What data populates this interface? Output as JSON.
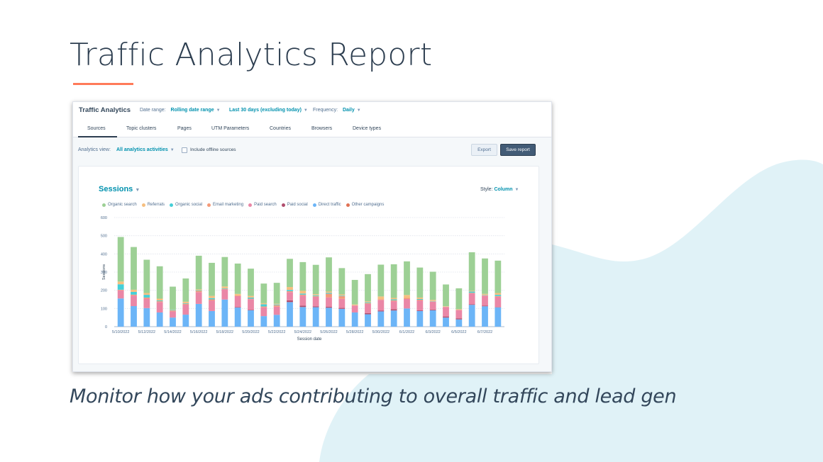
{
  "slide": {
    "title": "Traffic Analytics Report",
    "subtitle": "Monitor how your ads contributing to overall traffic and lead gen",
    "accent_color": "#ff7a59",
    "blob_color": "#e0f2f7"
  },
  "app": {
    "title": "Traffic Analytics",
    "filters": [
      {
        "label": "Date range:",
        "value": "Rolling date range"
      },
      {
        "label": "",
        "value": "Last 30 days (excluding today)"
      },
      {
        "label": "Frequency:",
        "value": "Daily"
      }
    ],
    "tabs": [
      "Sources",
      "Topic clusters",
      "Pages",
      "UTM Parameters",
      "Countries",
      "Browsers",
      "Device types"
    ],
    "active_tab": "Sources",
    "toolbar": {
      "analytics_view_label": "Analytics view:",
      "analytics_view_value": "All analytics activities",
      "include_offline_label": "Include offline sources",
      "include_offline_checked": false,
      "export_label": "Export",
      "save_label": "Save report"
    },
    "card": {
      "metric": "Sessions",
      "style_label": "Style:",
      "style_value": "Column"
    }
  },
  "chart_data": {
    "type": "bar",
    "stacked": true,
    "title": "Sessions",
    "xlabel": "Session date",
    "ylabel": "Sessions",
    "ylim": [
      0,
      600
    ],
    "yticks": [
      0,
      100,
      200,
      300,
      400,
      500,
      600
    ],
    "grid": true,
    "legend_position": "top-left",
    "categories": [
      "5/10/2022",
      "5/11/2022",
      "5/12/2022",
      "5/13/2022",
      "5/14/2022",
      "5/15/2022",
      "5/16/2022",
      "5/17/2022",
      "5/18/2022",
      "5/19/2022",
      "5/20/2022",
      "5/21/2022",
      "5/22/2022",
      "5/23/2022",
      "5/24/2022",
      "5/25/2022",
      "5/26/2022",
      "5/27/2022",
      "5/28/2022",
      "5/29/2022",
      "5/30/2022",
      "5/31/2022",
      "6/1/2022",
      "6/2/2022",
      "6/3/2022",
      "6/4/2022",
      "6/5/2022",
      "6/6/2022",
      "6/7/2022",
      "6/8/2022"
    ],
    "xtick_labels": [
      "5/10/2022",
      "5/12/2022",
      "5/14/2022",
      "5/16/2022",
      "5/18/2022",
      "5/20/2022",
      "5/22/2022",
      "5/24/2022",
      "5/26/2022",
      "5/28/2022",
      "5/30/2022",
      "6/1/2022",
      "6/3/2022",
      "6/5/2022",
      "6/7/2022"
    ],
    "series": [
      {
        "name": "Direct traffic",
        "color": "#6cb5f7",
        "values": [
          155,
          113,
          102,
          78,
          50,
          66,
          125,
          86,
          149,
          105,
          90,
          58,
          65,
          135,
          108,
          107,
          104,
          98,
          78,
          68,
          84,
          89,
          100,
          86,
          90,
          50,
          40,
          120,
          112,
          106
        ]
      },
      {
        "name": "Paid social",
        "color": "#b04e6e",
        "values": [
          0,
          0,
          0,
          0,
          0,
          0,
          0,
          0,
          0,
          3,
          3,
          0,
          0,
          10,
          8,
          5,
          5,
          5,
          0,
          7,
          5,
          7,
          0,
          4,
          4,
          6,
          6,
          3,
          3,
          2
        ]
      },
      {
        "name": "Paid search",
        "color": "#ea87a6",
        "values": [
          45,
          58,
          52,
          57,
          34,
          55,
          65,
          58,
          56,
          60,
          58,
          48,
          45,
          45,
          55,
          52,
          52,
          50,
          38,
          50,
          58,
          44,
          52,
          54,
          43,
          52,
          45,
          60,
          55,
          56
        ]
      },
      {
        "name": "Email marketing",
        "color": "#f49a78",
        "values": [
          3,
          5,
          6,
          5,
          5,
          5,
          7,
          6,
          3,
          4,
          3,
          5,
          8,
          5,
          5,
          4,
          20,
          15,
          2,
          5,
          4,
          5,
          6,
          4,
          2,
          2,
          2,
          3,
          2,
          4
        ]
      },
      {
        "name": "Organic social",
        "color": "#45cfd8",
        "values": [
          30,
          15,
          15,
          4,
          3,
          3,
          3,
          7,
          3,
          0,
          6,
          12,
          4,
          7,
          6,
          4,
          5,
          3,
          0,
          4,
          0,
          5,
          0,
          4,
          2,
          0,
          0,
          7,
          2,
          7
        ]
      },
      {
        "name": "Referrals",
        "color": "#f6bf80",
        "values": [
          15,
          12,
          10,
          10,
          2,
          8,
          5,
          12,
          10,
          8,
          9,
          6,
          4,
          16,
          15,
          6,
          7,
          6,
          4,
          5,
          15,
          8,
          16,
          8,
          6,
          2,
          3,
          4,
          6,
          10
        ]
      },
      {
        "name": "Organic search",
        "color": "#9dd095",
        "values": [
          245,
          235,
          183,
          178,
          126,
          128,
          185,
          182,
          162,
          167,
          150,
          108,
          115,
          155,
          158,
          162,
          188,
          145,
          135,
          150,
          175,
          185,
          185,
          165,
          155,
          120,
          115,
          212,
          195,
          178
        ]
      },
      {
        "name": "Other campaigns",
        "color": "#e07154",
        "values": [
          0,
          0,
          0,
          0,
          0,
          0,
          0,
          0,
          0,
          0,
          0,
          0,
          0,
          0,
          0,
          0,
          0,
          0,
          0,
          0,
          0,
          0,
          0,
          0,
          0,
          0,
          0,
          0,
          0,
          0
        ]
      }
    ]
  }
}
